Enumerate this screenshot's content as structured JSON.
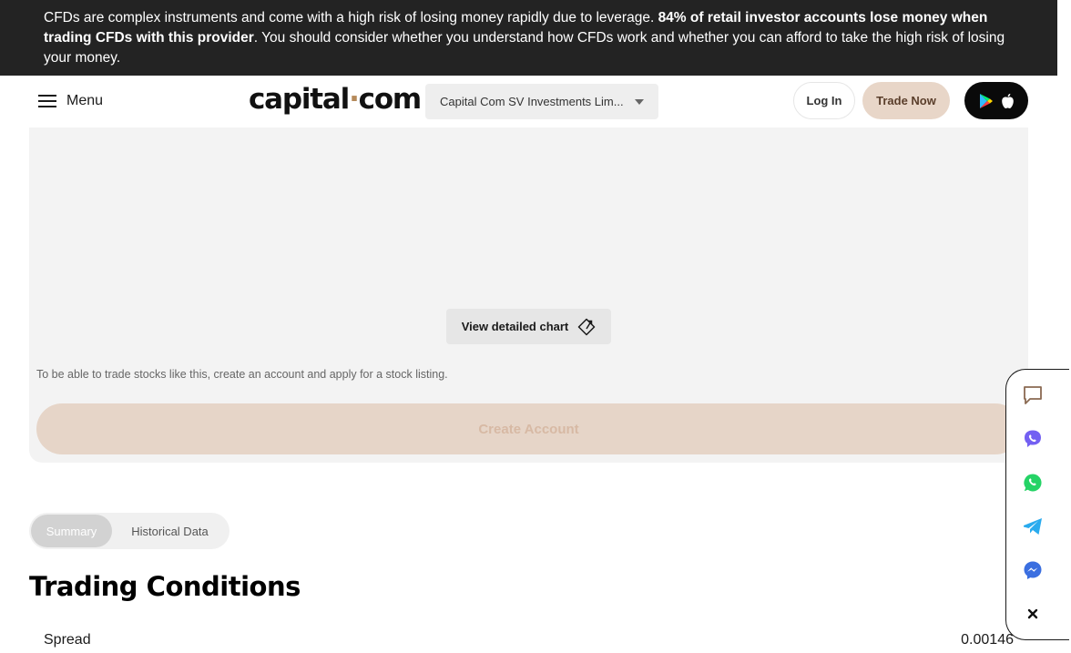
{
  "risk_banner": {
    "text_before": "CFDs are complex instruments and come with a high risk of losing money rapidly due to leverage. ",
    "text_bold": "84% of retail investor accounts lose money when trading CFDs with this provider",
    "text_after": ". You should consider whether you understand how CFDs work and whether you can afford to take the high risk of losing your money."
  },
  "header": {
    "menu_label": "Menu",
    "logo_left": "capital",
    "logo_dot": "·",
    "logo_right": "com",
    "entity_selected": "Capital Com SV Investments Lim...",
    "login_label": "Log In",
    "trade_label": "Trade Now",
    "icons": [
      "menu-icon",
      "caret-down-icon",
      "google-play-icon",
      "apple-icon"
    ]
  },
  "chart_panel": {
    "view_chart_label": "View detailed chart",
    "listing_note": "To be able to trade stocks like this, create an account and apply for a stock listing.",
    "create_account_label": "Create Account"
  },
  "tabs": [
    {
      "label": "Summary",
      "active": true
    },
    {
      "label": "Historical Data",
      "active": false
    }
  ],
  "trading_conditions": {
    "title": "Trading Conditions",
    "rows": [
      {
        "label": "Spread",
        "value": "0.00146"
      }
    ]
  },
  "social_bar": {
    "icons": [
      "chat-icon",
      "viber-icon",
      "whatsapp-icon",
      "telegram-icon",
      "messenger-icon",
      "close-icon"
    ]
  },
  "colors": {
    "banner_bg": "#232323",
    "accent_beige": "#e8d6c8",
    "accent_text": "#5a3e2b",
    "panel_bg": "#f3f3f3"
  }
}
